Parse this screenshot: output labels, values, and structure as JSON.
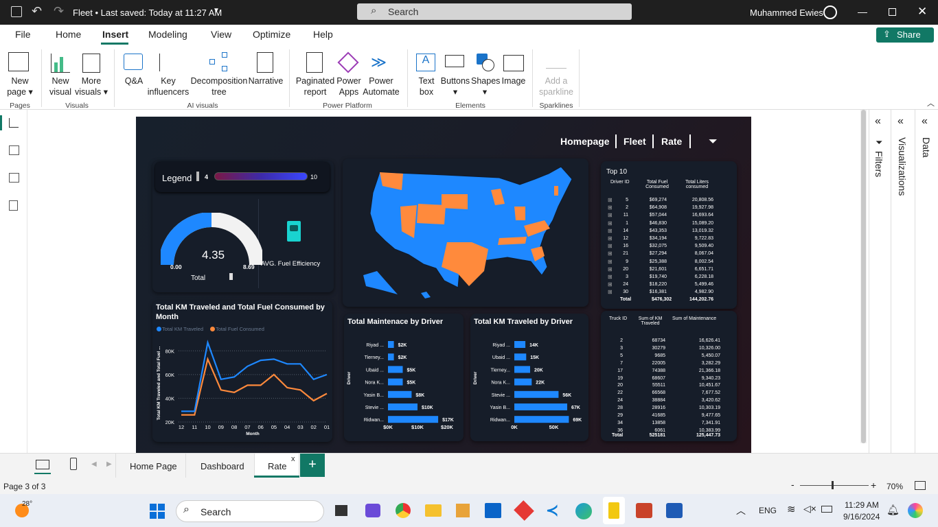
{
  "titlebar": {
    "title": "Fleet • Last saved: Today at 11:27 AM",
    "search_placeholder": "Search",
    "user": "Muhammed Ewies"
  },
  "menu": [
    "File",
    "Home",
    "Insert",
    "Modeling",
    "View",
    "Optimize",
    "Help"
  ],
  "share": "Share",
  "ribbon": {
    "new_page": [
      "New",
      "page"
    ],
    "new_visual": [
      "New",
      "visual"
    ],
    "more_visuals": [
      "More",
      "visuals"
    ],
    "qa": "Q&A",
    "key_influencers": [
      "Key",
      "influencers"
    ],
    "decomposition": [
      "Decomposition",
      "tree"
    ],
    "narrative": "Narrative",
    "paginated": [
      "Paginated",
      "report"
    ],
    "power_apps": [
      "Power",
      "Apps"
    ],
    "power_automate": [
      "Power",
      "Automate"
    ],
    "text_box": [
      "Text",
      "box"
    ],
    "buttons": "Buttons",
    "shapes": "Shapes",
    "image": "Image",
    "sparkline": [
      "Add a",
      "sparkline"
    ],
    "groups": {
      "pages": "Pages",
      "visuals": "Visuals",
      "ai": "AI visuals",
      "platform": "Power Platform",
      "elements": "Elements",
      "sparklines": "Sparklines"
    }
  },
  "report": {
    "nav": {
      "homepage": "Homepage",
      "fleet": "Fleet",
      "rate": "Rate"
    },
    "legend": {
      "label": "Legend",
      "min": "4",
      "max": "10"
    },
    "gauge": {
      "value": "4.35",
      "min": "0.00",
      "max": "8.69",
      "label": "Total",
      "fill_fraction": 0.5,
      "caption": "AVG. Fuel Efficiency"
    },
    "top10": {
      "title": "Top 10",
      "headers": [
        "Driver ID",
        "Total Fuel Consumed",
        "Total Liters consumed"
      ],
      "rows": [
        [
          "5",
          "$69,274",
          "20,808.56"
        ],
        [
          "2",
          "$64,908",
          "19,927.98"
        ],
        [
          "11",
          "$57,044",
          "16,693.64"
        ],
        [
          "1",
          "$46,830",
          "15,089.20"
        ],
        [
          "14",
          "$43,353",
          "13,019.32"
        ],
        [
          "12",
          "$34,194",
          "9,722.83"
        ],
        [
          "16",
          "$32,075",
          "9,509.40"
        ],
        [
          "21",
          "$27,294",
          "8,067.04"
        ],
        [
          "9",
          "$25,388",
          "8,002.54"
        ],
        [
          "20",
          "$21,601",
          "6,651.71"
        ],
        [
          "3",
          "$19,740",
          "6,228.18"
        ],
        [
          "24",
          "$18,220",
          "5,499.46"
        ],
        [
          "30",
          "$16,381",
          "4,982.90"
        ]
      ],
      "total": [
        "Total",
        "$476,302",
        "144,202.76"
      ]
    },
    "truck": {
      "headers": [
        "Truck ID",
        "Sum of KM Traveled",
        "Sum of Maintenance"
      ],
      "rows": [
        [
          "2",
          "68734",
          "16,626.41"
        ],
        [
          "3",
          "30279",
          "10,326.00"
        ],
        [
          "5",
          "9685",
          "5,450.07"
        ],
        [
          "7",
          "22005",
          "3,282.29"
        ],
        [
          "17",
          "74388",
          "21,366.18"
        ],
        [
          "19",
          "68607",
          "9,340.23"
        ],
        [
          "20",
          "55511",
          "10,451.67"
        ],
        [
          "22",
          "66568",
          "7,677.52"
        ],
        [
          "24",
          "38884",
          "3,420.62"
        ],
        [
          "28",
          "28916",
          "10,303.19"
        ],
        [
          "29",
          "41685",
          "9,477.65"
        ],
        [
          "34",
          "13858",
          "7,341.91"
        ],
        [
          "36",
          "6061",
          "10,383.99"
        ]
      ],
      "total": [
        "Total",
        "525181",
        "125,447.73"
      ]
    }
  },
  "chart_data": [
    {
      "type": "line",
      "title": "Total KM Traveled and Total Fuel Consumed by Month",
      "xlabel": "Month",
      "ylabel": "Total KM Traveled and Total Fuel ...",
      "categories": [
        "12",
        "11",
        "10",
        "09",
        "08",
        "07",
        "06",
        "05",
        "04",
        "03",
        "02",
        "01"
      ],
      "yticks": [
        "20K",
        "40K",
        "60K",
        "80K"
      ],
      "ylim": [
        20000,
        90000
      ],
      "series": [
        {
          "name": "Total KM Traveled",
          "color": "#1e88ff",
          "values": [
            29000,
            29000,
            87000,
            56000,
            58000,
            67000,
            72000,
            73000,
            69000,
            69000,
            56000,
            60000
          ]
        },
        {
          "name": "Total Fuel Consumed",
          "color": "#ff8a3c",
          "values": [
            26000,
            26000,
            73000,
            47000,
            45000,
            51000,
            51000,
            60000,
            49000,
            47000,
            38000,
            44000
          ]
        }
      ]
    },
    {
      "type": "bar",
      "title": "Total Maintenace by Driver",
      "ylabel": "Driver",
      "categories": [
        "Riyad ...",
        "Tierney...",
        "Ubaid ...",
        "Nora K...",
        "Yasin B...",
        "Stevie ...",
        "Ridwan..."
      ],
      "values": [
        2000,
        2000,
        5000,
        5000,
        8000,
        10000,
        17000
      ],
      "labels": [
        "$2K",
        "$2K",
        "$5K",
        "$5K",
        "$8K",
        "$10K",
        "$17K"
      ],
      "xticks": [
        "$0K",
        "$10K",
        "$20K"
      ],
      "xlim": [
        0,
        20000
      ]
    },
    {
      "type": "bar",
      "title": "Total KM Traveled by Driver",
      "ylabel": "Driver",
      "categories": [
        "Riyad ...",
        "Ubaid ...",
        "Tierney...",
        "Nora K...",
        "Stevie ...",
        "Yasin B...",
        "Ridwan..."
      ],
      "values": [
        14000,
        15000,
        20000,
        22000,
        56000,
        67000,
        69000
      ],
      "labels": [
        "14K",
        "15K",
        "20K",
        "22K",
        "56K",
        "67K",
        "69K"
      ],
      "xticks": [
        "0K",
        "50K"
      ],
      "xlim": [
        0,
        80000
      ]
    }
  ],
  "right": {
    "filters": "Filters",
    "visualizations": "Visualizations",
    "data": "Data"
  },
  "tabs": {
    "home": "Home Page",
    "dashboard": "Dashboard",
    "rate": "Rate",
    "close": "x",
    "add": "+"
  },
  "status": {
    "page": "Page 3 of 3",
    "zoom": "70%",
    "zoom_fraction": 0.46
  },
  "taskbar": {
    "temp": "28°",
    "search": "Search",
    "lang": "ENG",
    "time": "11:29 AM",
    "date": "9/16/2024"
  }
}
